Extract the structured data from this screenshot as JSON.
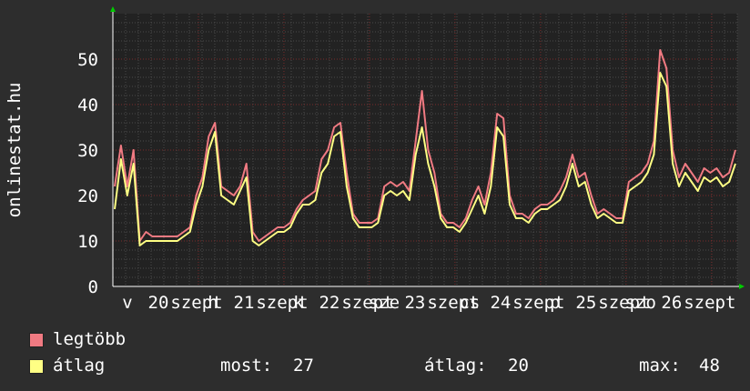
{
  "chart_data": {
    "type": "line",
    "ylabel": "onlinestat.hu",
    "ylim": [
      0,
      60
    ],
    "yticks": [
      0,
      10,
      20,
      30,
      40,
      50
    ],
    "xticks": [
      {
        "label": "v",
        "pos": 0.0
      },
      {
        "label": "20",
        "pos": 0.0
      },
      {
        "label": "szept",
        "pos": 0.0
      },
      {
        "label": "h",
        "pos": 0.0
      },
      {
        "label": "21",
        "pos": 0.0
      },
      {
        "label": "szept",
        "pos": 0.0
      },
      {
        "label": "k",
        "pos": 0.0
      },
      {
        "label": "22",
        "pos": 0.0
      },
      {
        "label": "szept",
        "pos": 0.0
      },
      {
        "label": "sze",
        "pos": 0.0
      },
      {
        "label": "23",
        "pos": 0.0
      },
      {
        "label": "szept",
        "pos": 0.0
      },
      {
        "label": "cs",
        "pos": 0.0
      },
      {
        "label": "24",
        "pos": 0.0
      },
      {
        "label": "szept",
        "pos": 0.0
      },
      {
        "label": "p",
        "pos": 0.0
      },
      {
        "label": "25",
        "pos": 0.0
      },
      {
        "label": "szept",
        "pos": 0.0
      },
      {
        "label": "szo",
        "pos": 0.0
      },
      {
        "label": "26",
        "pos": 0.0
      },
      {
        "label": "szept",
        "pos": 0.0
      }
    ],
    "series": [
      {
        "name": "legtöbb",
        "color": "#f07a82",
        "values": [
          22,
          31,
          22,
          30,
          10,
          12,
          11,
          11,
          11,
          11,
          11,
          12,
          13,
          20,
          24,
          33,
          36,
          22,
          21,
          20,
          22,
          27,
          12,
          10,
          11,
          12,
          13,
          13,
          14,
          17,
          19,
          20,
          21,
          28,
          30,
          35,
          36,
          25,
          16,
          14,
          14,
          14,
          15,
          22,
          23,
          22,
          23,
          21,
          32,
          43,
          30,
          25,
          16,
          14,
          14,
          13,
          15,
          19,
          22,
          18,
          25,
          38,
          37,
          20,
          16,
          16,
          15,
          17,
          18,
          18,
          19,
          21,
          24,
          29,
          24,
          25,
          20,
          16,
          17,
          16,
          15,
          15,
          23,
          24,
          25,
          27,
          32,
          52,
          48,
          30,
          24,
          27,
          25,
          23,
          26,
          25,
          26,
          24,
          25,
          30
        ]
      },
      {
        "name": "átlag",
        "color": "#ffff84",
        "values": [
          17,
          28,
          20,
          27,
          9,
          10,
          10,
          10,
          10,
          10,
          10,
          11,
          12,
          18,
          22,
          30,
          34,
          20,
          19,
          18,
          21,
          24,
          10,
          9,
          10,
          11,
          12,
          12,
          13,
          16,
          18,
          18,
          19,
          25,
          27,
          33,
          34,
          22,
          15,
          13,
          13,
          13,
          14,
          20,
          21,
          20,
          21,
          19,
          29,
          35,
          27,
          22,
          15,
          13,
          13,
          12,
          14,
          17,
          20,
          16,
          22,
          35,
          33,
          18,
          15,
          15,
          14,
          16,
          17,
          17,
          18,
          19,
          22,
          27,
          22,
          23,
          18,
          15,
          16,
          15,
          14,
          14,
          21,
          22,
          23,
          25,
          29,
          47,
          44,
          27,
          22,
          25,
          23,
          21,
          24,
          23,
          24,
          22,
          23,
          27
        ]
      }
    ],
    "stats": {
      "now_label": "most:",
      "now": "27",
      "avg_label": "átlag:",
      "avg": "20",
      "max_label": "max:",
      "max": "48"
    },
    "colors": {
      "background": "#2d2d2d",
      "plot_bg": "#222222",
      "grid_major": "#7a2a2a",
      "grid_minor": "#4a4a4a",
      "axis": "#ffffff",
      "arrow": "#00cc00"
    }
  }
}
